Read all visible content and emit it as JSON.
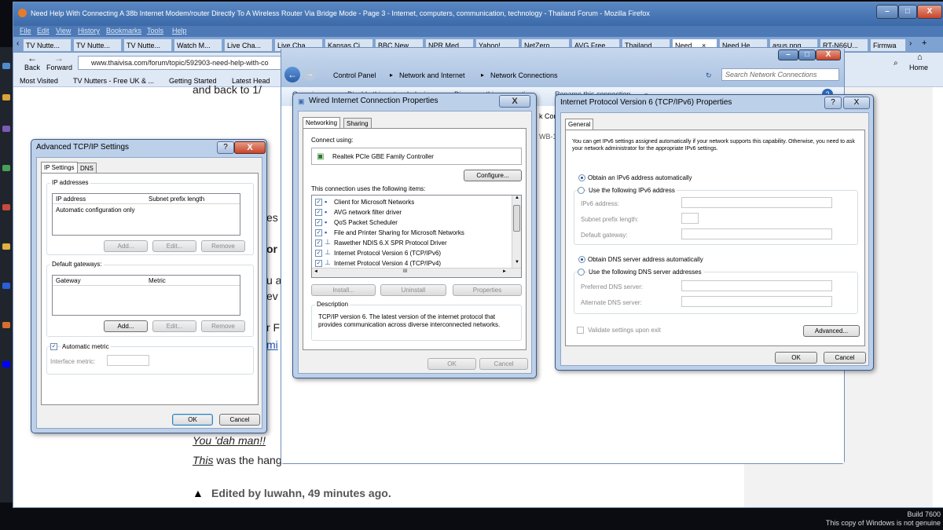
{
  "firefox": {
    "title": "Need Help With Connecting A 38b Internet Modem/router Directly To A Wireless Router Via Bridge Mode - Page 3 - Internet, computers, communication, technology - Thailand Forum - Mozilla Firefox",
    "menu": [
      "File",
      "Edit",
      "View",
      "History",
      "Bookmarks",
      "Tools",
      "Help"
    ],
    "tabs": [
      "TV Nutte...",
      "TV Nutte...",
      "TV Nutte...",
      "Watch M...",
      "Live Cha...",
      "Live Cha...",
      "Kansas Ci...",
      "BBC New...",
      "NPR Med...",
      "Yahoo!",
      "NetZero ...",
      "AVG Free...",
      "Thailand ...",
      "Need ...",
      "Need He...",
      "asus.png ...",
      "RT-N66U...",
      "Firmwa"
    ],
    "back_label": "Back",
    "forward_label": "Forward",
    "url": "www.thaivisa.com/forum/topic/592903-need-help-with-co",
    "home_label": "Home",
    "bookmarks": [
      "Most Visited",
      "TV Nutters - Free UK & ...",
      "Getting Started",
      "Latest Head"
    ],
    "page": {
      "line1": "and back to 1/",
      "frag_es": "es",
      "frag_or": "or",
      "frag_ua": "u a",
      "frag_ev": "ev",
      "frag_r": "r F",
      "frag_mi": "mi",
      "quote1": "You 'dah man!!",
      "quote2_em": "This",
      "quote2_rest": " was the hang",
      "edited": "Edited by luwahn, 49 minutes ago."
    }
  },
  "explorer": {
    "breadcrumb": [
      "Control Panel",
      "Network and Internet",
      "Network Connections"
    ],
    "search_placeholder": "Search Network Connections",
    "toolbar": [
      "Organize",
      "Disable this network device",
      "Diagnose this connection",
      "Rename this connection",
      "»"
    ],
    "partial_conn": "k Conn",
    "partial_dev": "WB-1N"
  },
  "adv_tcpip": {
    "title": "Advanced TCP/IP Settings",
    "tabs": [
      "IP Settings",
      "DNS"
    ],
    "ip_group": "IP addresses",
    "ip_cols": [
      "IP address",
      "Subnet prefix length"
    ],
    "ip_rows": [
      "Automatic configuration only"
    ],
    "gw_group": "Default gateways:",
    "gw_cols": [
      "Gateway",
      "Metric"
    ],
    "btn_add": "Add...",
    "btn_edit": "Edit...",
    "btn_remove": "Remove",
    "auto_metric": "Automatic metric",
    "iface_metric": "Interface metric:",
    "ok": "OK",
    "cancel": "Cancel"
  },
  "wired": {
    "title": "Wired Internet Connection Properties",
    "tabs": [
      "Networking",
      "Sharing"
    ],
    "connect_using": "Connect using:",
    "adapter": "Realtek PCIe GBE Family Controller",
    "configure": "Configure...",
    "uses_label": "This connection uses the following items:",
    "items": [
      {
        "label": "Client for Microsoft Networks",
        "checked": true
      },
      {
        "label": "AVG network filter driver",
        "checked": true
      },
      {
        "label": "QoS Packet Scheduler",
        "checked": true
      },
      {
        "label": "File and Printer Sharing for Microsoft Networks",
        "checked": true
      },
      {
        "label": "Rawether NDIS 6.X SPR Protocol Driver",
        "checked": true
      },
      {
        "label": "Internet Protocol Version 6 (TCP/IPv6)",
        "checked": true
      },
      {
        "label": "Internet Protocol Version 4 (TCP/IPv4)",
        "checked": true
      }
    ],
    "scroll_mid": "III",
    "install": "Install...",
    "uninstall": "Uninstall",
    "properties": "Properties",
    "desc_label": "Description",
    "desc_text": "TCP/IP version 6. The latest version of the internet protocol that provides communication across diverse interconnected networks.",
    "ok": "OK",
    "cancel": "Cancel"
  },
  "ipv6": {
    "title": "Internet Protocol Version 6 (TCP/IPv6) Properties",
    "tab": "General",
    "intro": "You can get IPv6 settings assigned automatically if your network supports this capability. Otherwise, you need to ask your network administrator for the appropriate IPv6 settings.",
    "obtain_auto": "Obtain an IPv6 address automatically",
    "use_following": "Use the following IPv6 address",
    "ipv6_address": "IPv6 address:",
    "subnet_prefix": "Subnet prefix length:",
    "default_gateway": "Default gateway:",
    "obtain_dns": "Obtain DNS server address automatically",
    "use_dns": "Use the following DNS server addresses",
    "preferred_dns": "Preferred DNS server:",
    "alternate_dns": "Alternate DNS server:",
    "validate": "Validate settings upon exit",
    "advanced": "Advanced...",
    "ok": "OK",
    "cancel": "Cancel"
  },
  "watermark": {
    "build": "Build 7600",
    "notice": "This copy of Windows is not genuine"
  }
}
